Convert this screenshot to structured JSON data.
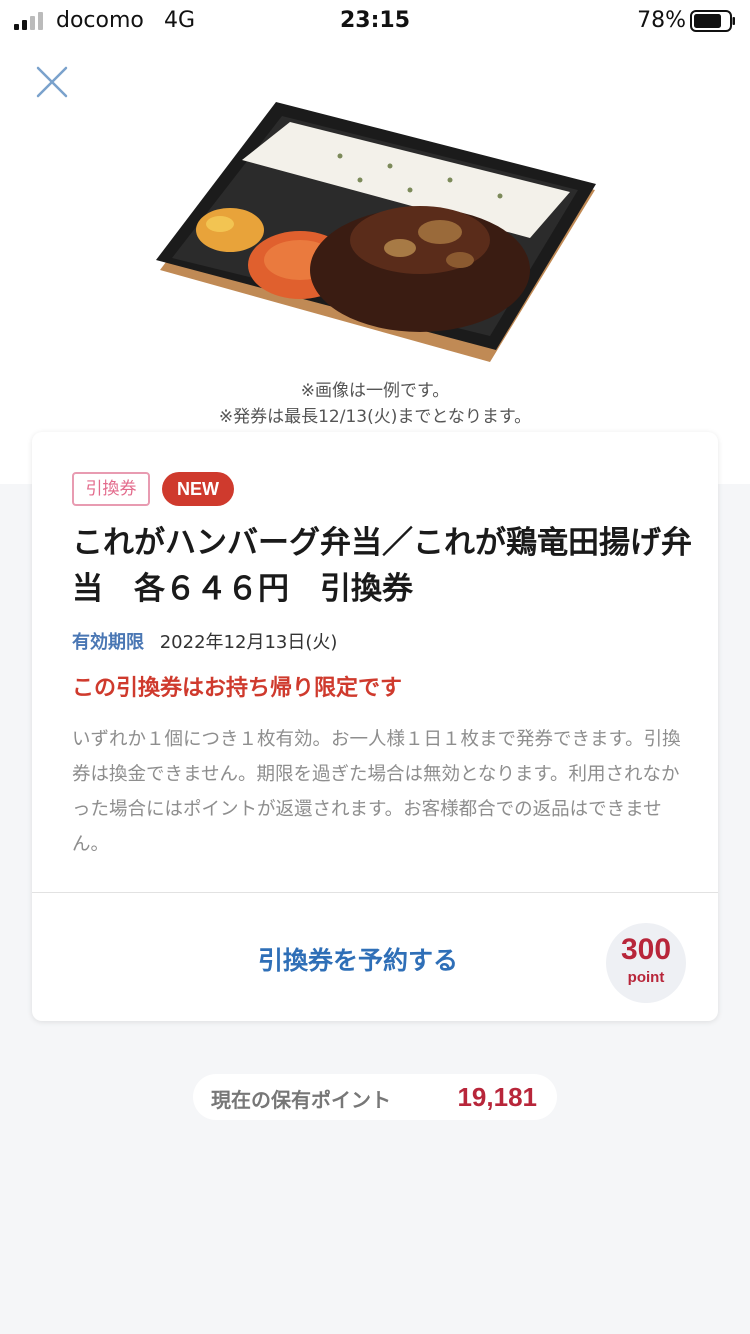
{
  "status_bar": {
    "carrier": "docomo",
    "network": "4G",
    "time": "23:15",
    "battery": "78%"
  },
  "header": {
    "close_icon": "close-x-icon"
  },
  "image": {
    "caption_1": "※画像は一例です。",
    "caption_2": "※発券は最長12/13(火)までとなります。"
  },
  "voucher": {
    "tag_label": "引換券",
    "new_badge": "NEW",
    "title": "これがハンバーグ弁当／これが鶏竜田揚げ弁当　各６４６円　引換券",
    "validity_label": "有効期限",
    "validity_date": "2022年12月13日(火)",
    "takeout_notice": "この引換券はお持ち帰り限定です",
    "description": "いずれか１個につき１枚有効。お一人様１日１枚まで発券できます。引換券は換金できません。期限を過ぎた場合は無効となります。利用されなかった場合にはポイントが返還されます。お客様都合での返品はできません。",
    "reserve_label": "引換券を予約する",
    "point_cost": "300",
    "point_unit": "point"
  },
  "points": {
    "label": "現在の保有ポイント",
    "value": "19,181"
  },
  "colors": {
    "accent_blue": "#2f6fb7",
    "accent_red": "#cf3a2d",
    "point_red": "#b8263a",
    "tag_pink": "#e36b8c"
  }
}
